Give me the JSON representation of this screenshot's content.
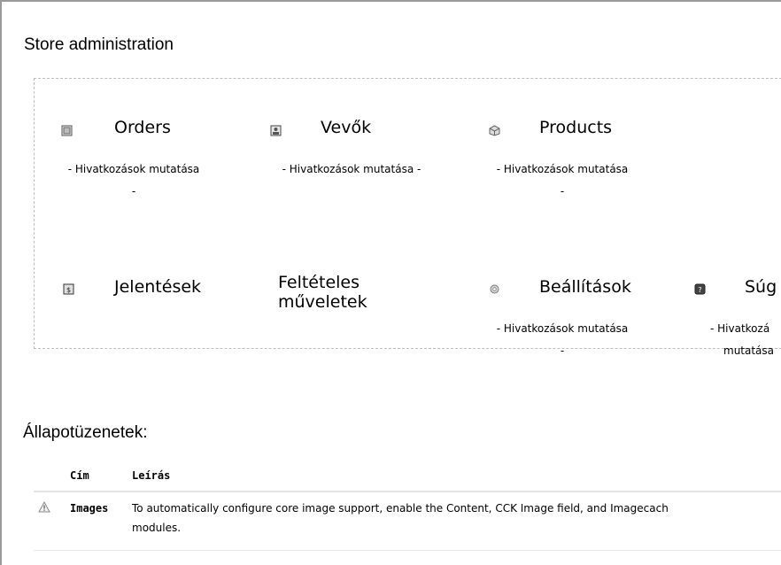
{
  "page": {
    "title": "Store administration"
  },
  "admin_blocks": [
    {
      "title": "Orders",
      "icon": "orders-icon",
      "link_line1": "- Hivatkozások mutatása",
      "link_line2": "-"
    },
    {
      "title": "Vevők",
      "icon": "customers-icon",
      "link_line1": "- Hivatkozások mutatása -",
      "link_line2": ""
    },
    {
      "title": "Products",
      "icon": "products-icon",
      "link_line1": "- Hivatkozások mutatása",
      "link_line2": "-"
    },
    {
      "title": "Jelentések",
      "icon": "reports-icon",
      "link_line1": "",
      "link_line2": ""
    },
    {
      "title": "Feltételes műveletek",
      "title_line1": "Feltételes",
      "title_line2": "műveletek",
      "icon": "",
      "link_line1": "",
      "link_line2": ""
    },
    {
      "title": "Beállítások",
      "icon": "settings-icon",
      "link_line1": "- Hivatkozások mutatása",
      "link_line2": "-"
    },
    {
      "title": "Súg",
      "icon": "help-icon",
      "link_line1": "- Hivatkozá",
      "link_line2": "mutatása"
    }
  ],
  "status": {
    "heading": "Állapotüzenetek:",
    "col_title": "Cím",
    "col_desc": "Leírás",
    "rows": [
      {
        "icon": "warning-icon",
        "title": "Images",
        "desc_line1": "To automatically configure core image support, enable the Content, CCK Image field, and Imagecach",
        "desc_line2": "modules."
      }
    ]
  }
}
